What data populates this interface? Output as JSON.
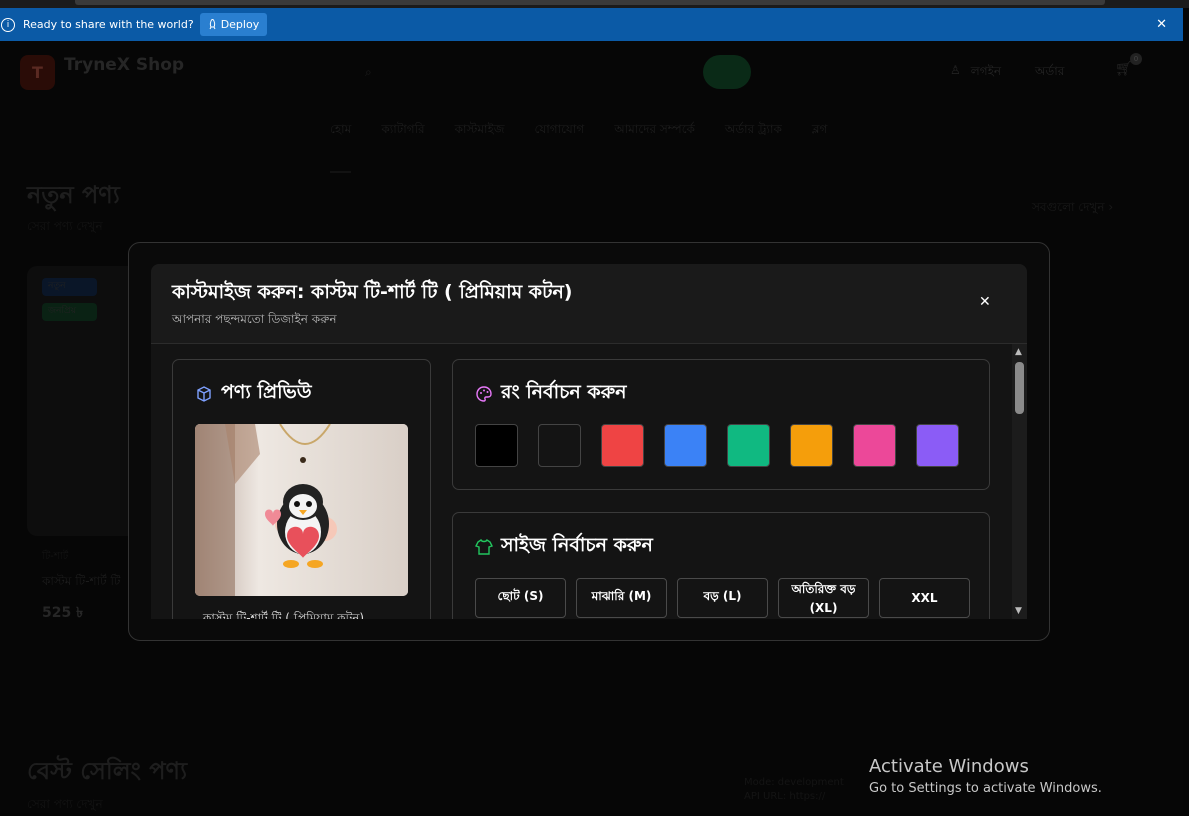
{
  "ide_bar": {
    "info_icon": "info-icon",
    "message": "Ready to share with the world?",
    "deploy_label": "Deploy",
    "close_icon": "close-icon"
  },
  "header": {
    "brand": "TryneX Shop",
    "brand_sub": "",
    "login_label": "লগইন",
    "orders_label": "অর্ডার",
    "cart_count": "0"
  },
  "nav": {
    "items": [
      "হোম",
      "ক্যাটাগরি",
      "কাস্টমাইজ",
      "যোগাযোগ",
      "আমাদের সম্পর্কে",
      "অর্ডার ট্র্যাক",
      "ব্লগ"
    ]
  },
  "section_new": {
    "title": "নতুন পণ্য",
    "subtitle": "সেরা পণ্য দেখুন",
    "view_all": "সবগুলো দেখুন",
    "card": {
      "tag1": "নতুন",
      "tag2": "জনপ্রিয়",
      "category": "টি-শার্ট",
      "name": "কাস্টম টি-শার্ট টি",
      "price": "525 ৳"
    }
  },
  "section_best": {
    "title": "বেস্ট সেলিং পণ্য",
    "subtitle": "সেরা পণ্য দেখুন"
  },
  "dev_info": {
    "line1": "Mode: development",
    "line2": "API URL: https://"
  },
  "windows_activation": {
    "title": "Activate Windows",
    "subtitle": "Go to Settings to activate Windows."
  },
  "modal": {
    "title": "কাস্টমাইজ করুন: কাস্টম টি-শার্ট টি ( প্রিমিয়াম কটন)",
    "subtitle": "আপনার পছন্দমতো ডিজাইন করুন",
    "preview": {
      "title": "পণ্য প্রিভিউ",
      "icon": "box-icon",
      "caption": "কাস্টম টি-শার্ট টি ( প্রিমিয়াম কটন)"
    },
    "color_section": {
      "title": "রং নির্বাচন করুন",
      "icon": "palette-icon",
      "colors": [
        "#000000",
        "#141414",
        "#ef4444",
        "#3b82f6",
        "#10b981",
        "#f59e0b",
        "#ec4899",
        "#8b5cf6"
      ]
    },
    "size_section": {
      "title": "সাইজ নির্বাচন করুন",
      "icon": "shirt-icon",
      "sizes": [
        "ছোট (S)",
        "মাঝারি (M)",
        "বড় (L)",
        "অতিরিক্ত বড় (XL)",
        "XXL"
      ]
    }
  }
}
